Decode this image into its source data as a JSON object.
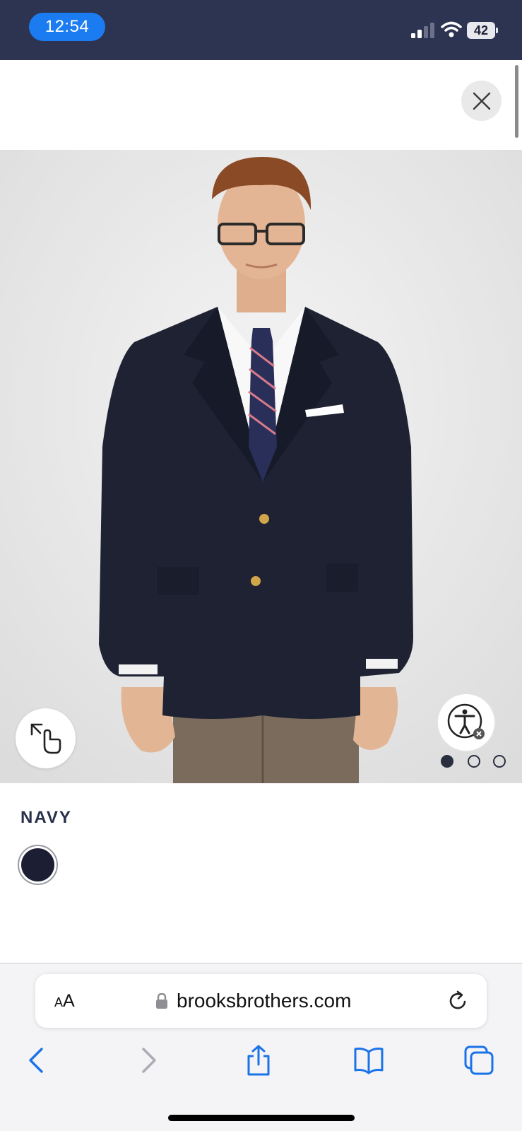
{
  "status_bar": {
    "time": "12:54",
    "battery_level": "42",
    "icons": [
      "signal-icon",
      "wifi-icon",
      "battery-icon"
    ]
  },
  "modal": {
    "close_icon": "close-icon"
  },
  "product": {
    "gallery_icons": [
      "expand-icon",
      "accessibility-icon"
    ],
    "image_count": 3,
    "active_image": 1
  },
  "color_selector": {
    "selected_name": "NAVY",
    "swatches": [
      {
        "name": "NAVY",
        "hex": "#1c1f33",
        "selected": true
      }
    ]
  },
  "browser": {
    "text_size_small": "A",
    "text_size_large": "A",
    "url": "brooksbrothers.com",
    "icons": [
      "lock-icon",
      "reload-icon",
      "back-icon",
      "forward-icon",
      "share-icon",
      "bookmarks-icon",
      "tabs-icon"
    ]
  },
  "colors": {
    "status_bar_bg": "#2c3451",
    "time_pill": "#1b7cf2",
    "safari_blue": "#1a73e8",
    "text_dark": "#28304a"
  }
}
